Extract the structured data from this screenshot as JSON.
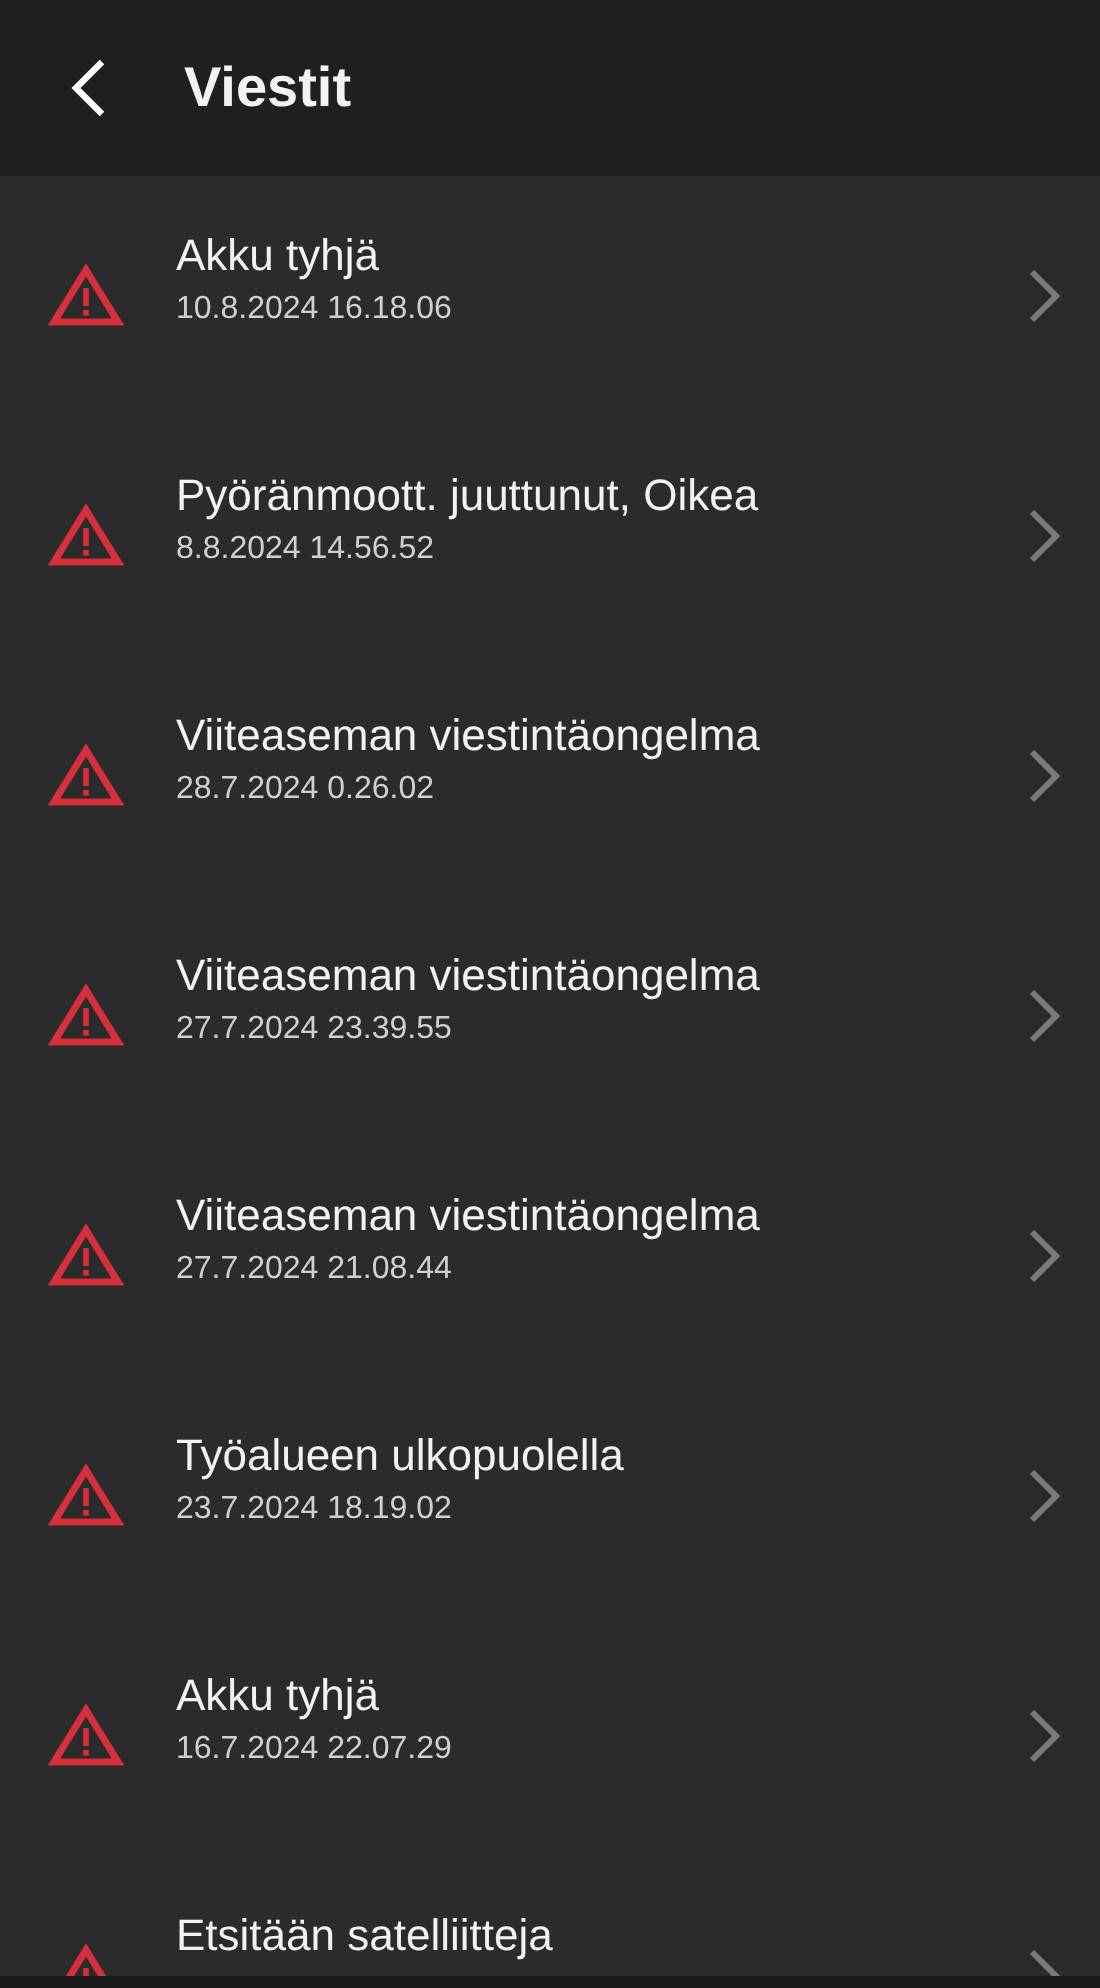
{
  "header": {
    "title": "Viestit"
  },
  "messages": [
    {
      "title": "Akku tyhjä",
      "date": "10.8.2024 16.18.06"
    },
    {
      "title": "Pyöränmoott. juuttunut, Oikea",
      "date": "8.8.2024 14.56.52"
    },
    {
      "title": "Viiteaseman viestintäongelma",
      "date": "28.7.2024 0.26.02"
    },
    {
      "title": "Viiteaseman viestintäongelma",
      "date": "27.7.2024 23.39.55"
    },
    {
      "title": "Viiteaseman viestintäongelma",
      "date": "27.7.2024 21.08.44"
    },
    {
      "title": "Työalueen ulkopuolella",
      "date": "23.7.2024 18.19.02"
    },
    {
      "title": "Akku tyhjä",
      "date": "16.7.2024 22.07.29"
    },
    {
      "title": "Etsitään satelliitteja"
    }
  ]
}
